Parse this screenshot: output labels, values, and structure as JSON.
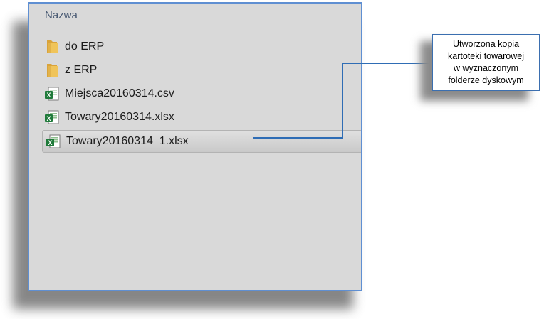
{
  "explorer": {
    "column_header": "Nazwa",
    "items": [
      {
        "label": "do ERP",
        "type": "folder"
      },
      {
        "label": "z ERP",
        "type": "folder"
      },
      {
        "label": "Miejsca20160314.csv",
        "type": "excel"
      },
      {
        "label": "Towary20160314.xlsx",
        "type": "excel"
      },
      {
        "label": "Towary20160314_1.xlsx",
        "type": "excel",
        "selected": true
      }
    ]
  },
  "callout": {
    "lines": [
      "Utworzona kopia",
      "kartoteki towarowej",
      "w wyznaczonym",
      "folderze dyskowym"
    ]
  },
  "colors": {
    "panel_border": "#5f8fd2",
    "panel_bg": "#d9d9d9",
    "connector": "#2f6db5",
    "folder": "#e8b84a",
    "excel_green": "#1f7a3a"
  }
}
